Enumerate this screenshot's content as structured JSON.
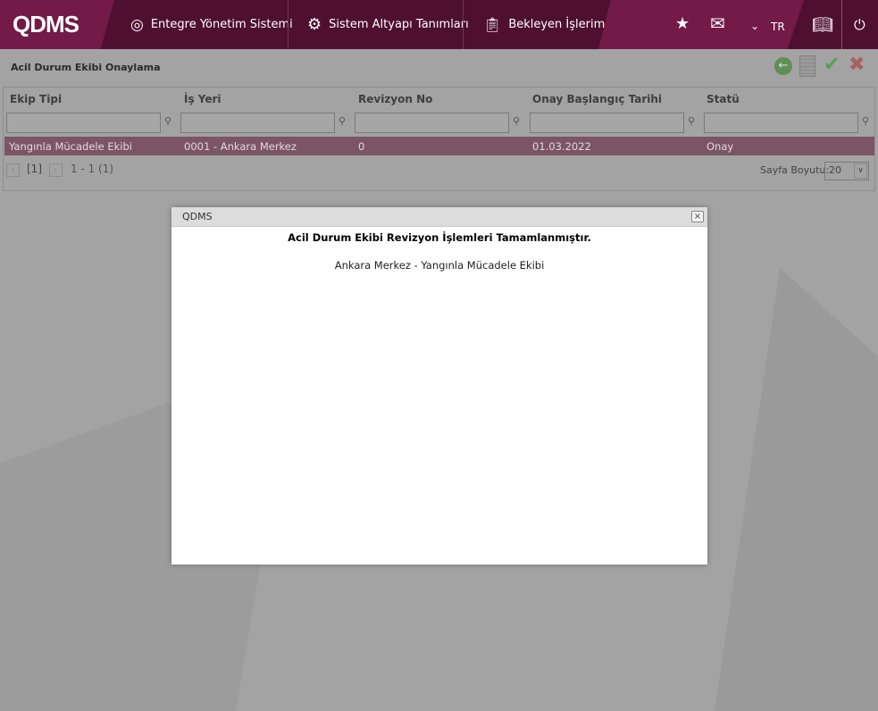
{
  "header": {
    "logo": "QDMS",
    "nav": [
      "Entegre Yönetim Sistemi",
      "Sistem Altyapı Tanımları",
      "Bekleyen İşlerim"
    ],
    "language": "TR"
  },
  "panel": {
    "title": "Acil Durum Ekibi Onaylama"
  },
  "grid": {
    "columns": [
      "Ekip Tipi",
      "İş Yeri",
      "Revizyon No",
      "Onay Başlangıç Tarihi",
      "Statü"
    ],
    "rows": [
      [
        "Yangınla Mücadele Ekibi",
        "0001 - Ankara Merkez",
        "0",
        "01.03.2022",
        "Onay"
      ]
    ]
  },
  "pager": {
    "current": "[1]",
    "range": "1 - 1 (1)",
    "page_size_label": "Sayfa Boyutu:",
    "page_size": "20"
  },
  "dialog": {
    "title": "QDMS",
    "heading": "Acil Durum Ekibi Revizyon İşlemleri Tamamlanmıştır.",
    "message": "Ankara Merkez - Yangınla Mücadele Ekibi",
    "close": "×"
  }
}
